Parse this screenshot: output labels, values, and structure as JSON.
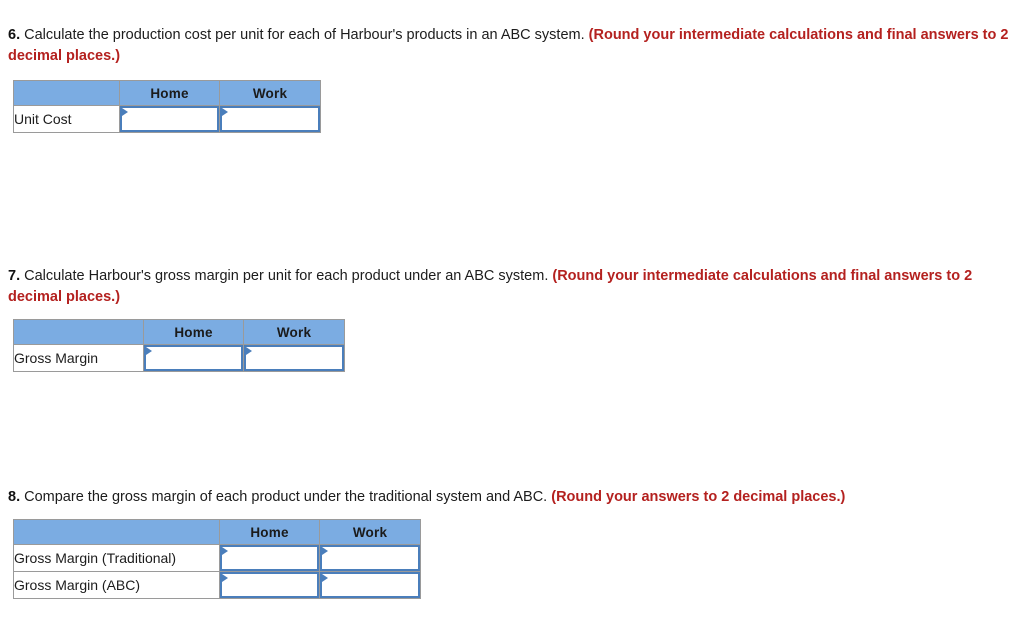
{
  "page": {
    "background_color": "#ffffff",
    "text_color": "#1c1c1c",
    "note_color": "#b4211f",
    "header_fill_color": "#7BACE2",
    "input_border_color": "#4A7EBB",
    "table_border_color": "#9a9a9a"
  },
  "questions": [
    {
      "number": "6.",
      "body": "Calculate the production cost per unit for each of Harbour's products in an ABC system.",
      "note": "(Round your intermediate calculations and final answers to 2 decimal places.)"
    },
    {
      "number": "7.",
      "body": "Calculate Harbour's gross margin per unit for each product under an ABC system.",
      "note": "(Round your intermediate calculations and final answers to 2 decimal places.)"
    },
    {
      "number": "8.",
      "body": "Compare the gross margin of each product under the traditional system and ABC.",
      "note": "(Round your answers to 2 decimal places.)"
    }
  ],
  "tables": [
    {
      "id": "unit-cost",
      "corner_header": "",
      "columns": [
        "Home",
        "Work"
      ],
      "rows": [
        {
          "label": "Unit Cost",
          "values": [
            "",
            ""
          ]
        }
      ]
    },
    {
      "id": "gross-margin",
      "corner_header": "",
      "columns": [
        "Home",
        "Work"
      ],
      "rows": [
        {
          "label": "Gross Margin",
          "values": [
            "",
            ""
          ]
        }
      ]
    },
    {
      "id": "gross-margin-compare",
      "corner_header": "",
      "columns": [
        "Home",
        "Work"
      ],
      "rows": [
        {
          "label": "Gross Margin (Traditional)",
          "values": [
            "",
            ""
          ]
        },
        {
          "label": "Gross Margin (ABC)",
          "values": [
            "",
            ""
          ]
        }
      ]
    }
  ]
}
